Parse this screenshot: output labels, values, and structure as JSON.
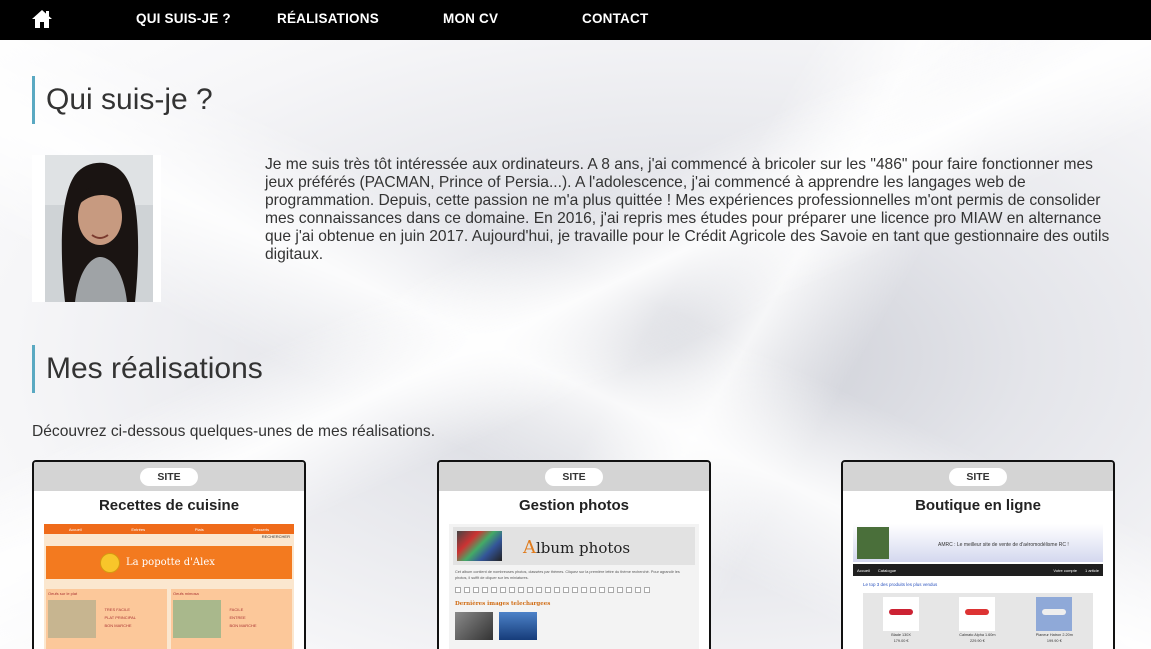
{
  "nav": {
    "home_icon": "home-icon",
    "items": [
      "QUI SUIS-JE ?",
      "RÉALISATIONS",
      "MON CV",
      "CONTACT"
    ]
  },
  "about": {
    "title": "Qui suis-je ?",
    "bio": "Je me suis très tôt intéressée aux ordinateurs. A 8 ans, j'ai commencé à bricoler sur les \"486\" pour faire fonctionner mes jeux préférés (PACMAN, Prince of Persia...). A l'adolescence, j'ai commencé à apprendre les langages web de programmation. Depuis, cette passion ne m'a plus quittée ! Mes expériences professionnelles m'ont permis de consolider mes connaissances dans ce domaine. En 2016, j'ai repris mes études pour préparer une licence pro MIAW en alternance que j'ai obtenue en juin 2017. Aujourd'hui, je travaille pour le Crédit Agricole des Savoie en tant que gestionnaire des outils digitaux."
  },
  "works": {
    "title": "Mes réalisations",
    "intro": "Découvrez ci-dessous quelques-unes de mes réalisations.",
    "cards": [
      {
        "badge": "SITE",
        "title": "Recettes de cuisine",
        "shot": {
          "menu": [
            "Accueil",
            "Entrées",
            "Plats",
            "Desserts"
          ],
          "search_btn": "RECHERCHER",
          "banner": "La popotte d'Alex",
          "col1_title": "Oeufs sur le plat",
          "col1_items": [
            "TRES FACILE",
            "PLAT PRINCIPAL",
            "BON MARCHE"
          ],
          "col2_title": "Oeufs mimosa",
          "col2_items": [
            "FACILE",
            "ENTREE",
            "BON MARCHE"
          ]
        }
      },
      {
        "badge": "SITE",
        "title": "Gestion photos",
        "shot": {
          "logo_first": "A",
          "logo_rest": "lbum photos",
          "text": "Cet album contient de nombreuses photos, classées par thèmes. Cliquez sur la première lettre du thème recherché. Pour agrandir les photos, il suffit de cliquer sur les miniatures.",
          "subtitle": "Dernières images telechargees"
        }
      },
      {
        "badge": "SITE",
        "title": "Boutique en ligne",
        "shot": {
          "tagline": "AMRC : Le meilleur site de vente de d'aéromodélisme RC !",
          "bar_left": [
            "Accueil",
            "Catalogue"
          ],
          "bar_right": [
            "Votre compte",
            "1 article"
          ],
          "top3": "Le top 3 des produits les plus vendus",
          "products": [
            {
              "name": "Blade 130X",
              "price": "179.00 €"
            },
            {
              "name": "Calmato Alpha 1.60m",
              "price": "229.90 €"
            },
            {
              "name": "Planeur Hatron 2.20m",
              "price": "199.90 €"
            }
          ]
        }
      }
    ]
  }
}
